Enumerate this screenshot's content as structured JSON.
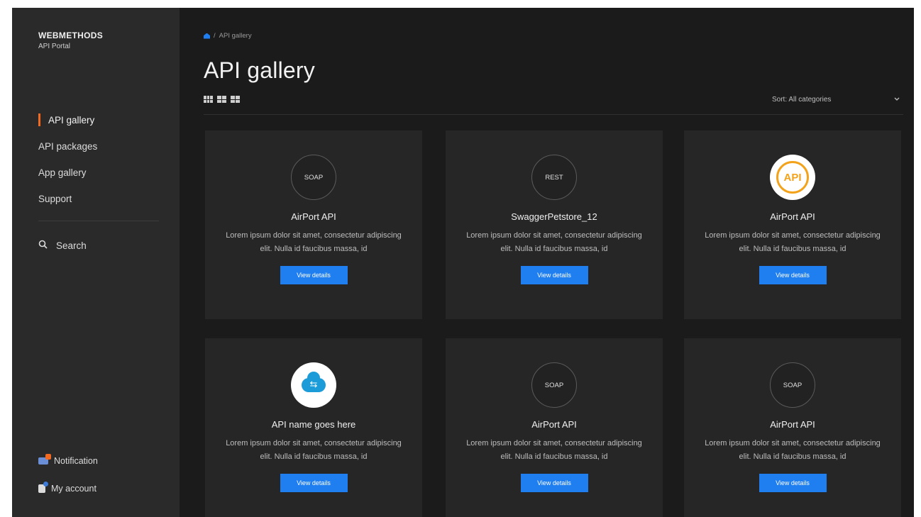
{
  "brand": {
    "name": "WEBMETHODS",
    "subtitle": "API Portal"
  },
  "sidebar": {
    "nav": [
      {
        "label": "API gallery",
        "active": true
      },
      {
        "label": "API packages",
        "active": false
      },
      {
        "label": "App gallery",
        "active": false
      },
      {
        "label": "Support",
        "active": false
      }
    ],
    "search": {
      "label": "Search",
      "icon": "search-icon"
    },
    "bottom": [
      {
        "label": "Notification",
        "icon": "bell-icon"
      },
      {
        "label": "My account",
        "icon": "user-icon"
      }
    ]
  },
  "header": {
    "breadcrumb": {
      "home_icon": "home-icon",
      "separator": "/",
      "current": "API gallery"
    },
    "title": "API gallery",
    "sort": {
      "label": "Sort:",
      "value": "All categories"
    },
    "view_toggles": [
      "grid-3-view-icon",
      "grid-2-view-icon",
      "grid-view-icon"
    ]
  },
  "cards": [
    {
      "logo": "SOAP",
      "title": "AirPort API",
      "desc": "Lorem ipsum dolor sit amet, consectetur adipiscing elit. Nulla id faucibus massa, id",
      "button": "View details"
    },
    {
      "logo": "REST",
      "title": "SwaggerPetstore_12",
      "desc": "Lorem ipsum dolor sit amet, consectetur adipiscing elit. Nulla id faucibus massa, id",
      "button": "View details"
    },
    {
      "logo": "API",
      "title": "AirPort API",
      "desc": "Lorem ipsum dolor sit amet, consectetur adipiscing elit. Nulla id faucibus massa, id",
      "button": "View details"
    },
    {
      "logo": "cloud",
      "title": "API name goes here",
      "desc": "Lorem ipsum dolor sit amet, consectetur adipiscing elit. Nulla id faucibus massa, id",
      "button": "View details"
    },
    {
      "logo": "SOAP",
      "title": "AirPort API",
      "desc": "Lorem ipsum dolor sit amet, consectetur adipiscing elit. Nulla id faucibus massa, id",
      "button": "View details"
    },
    {
      "logo": "SOAP",
      "title": "AirPort API",
      "desc": "Lorem ipsum dolor sit amet, consectetur adipiscing elit. Nulla id faucibus massa, id",
      "button": "View details"
    }
  ],
  "colors": {
    "accent": "#1f7ef0",
    "active_marker": "#f26a21",
    "sidebar_bg": "#2a2a2a",
    "main_bg": "#1b1b1b",
    "card_bg": "#262626"
  }
}
